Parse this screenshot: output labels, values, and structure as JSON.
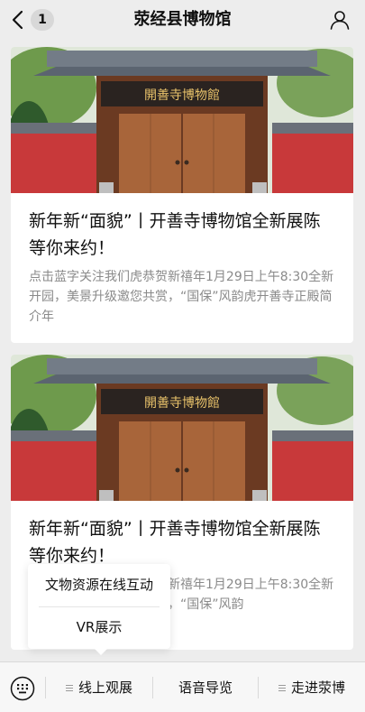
{
  "header": {
    "title": "荥经县博物馆",
    "unread_badge": "1",
    "back_icon": "chevron-left-icon",
    "profile_icon": "user-icon"
  },
  "articles": [
    {
      "image_sign": "開善寺博物館",
      "title": "新年新“面貌”丨开善寺博物馆全新展陈等你来约！",
      "desc": "点击蓝字关注我们虎恭贺新禧年1月29日上午8:30全新开园，美景升级邀您共赏，“国保”风韵虎开善寺正殿简介年"
    },
    {
      "image_sign": "開善寺博物館",
      "title": "新年新“面貌”丨开善寺博物馆全新展陈等你来约！",
      "desc": "点击蓝字关注我们虎恭贺新禧年1月29日上午8:30全新开园，美景升级邀您共赏，“国保”风韵"
    }
  ],
  "submenu": {
    "items": [
      "文物资源在线互动",
      "VR展示"
    ]
  },
  "menu": {
    "keyboard_icon": "keyboard-icon",
    "items": [
      "线上观展",
      "语音导览",
      "走进荥博"
    ]
  },
  "colors": {
    "background": "#ededed",
    "card": "#ffffff",
    "desc_text": "#8a8a8a",
    "wall_red": "#c8393a",
    "roof_grey": "#5b6470",
    "door_wood": "#a8653a"
  }
}
